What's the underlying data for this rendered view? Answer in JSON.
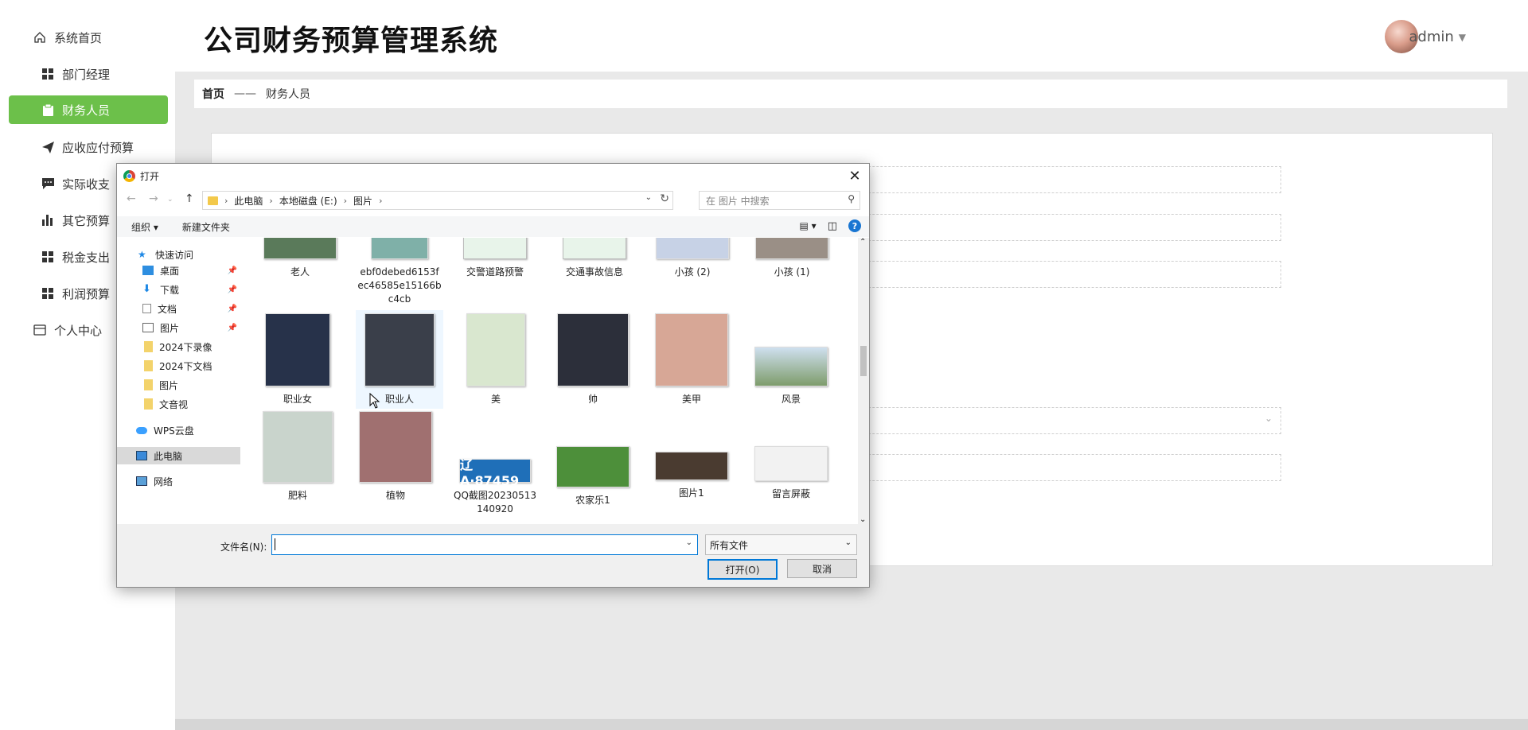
{
  "app": {
    "title": "公司财务预算管理系统",
    "user": "admin"
  },
  "sidebar": {
    "items": [
      {
        "label": "系统首页",
        "icon": "home-icon"
      },
      {
        "label": "部门经理",
        "icon": "grid-icon"
      },
      {
        "label": "财务人员",
        "icon": "clipboard-icon",
        "active": true
      },
      {
        "label": "应收应付预算",
        "icon": "send-icon"
      },
      {
        "label": "实际收支",
        "icon": "chat-icon"
      },
      {
        "label": "其它预算",
        "icon": "bar-chart-icon"
      },
      {
        "label": "税金支出",
        "icon": "grid-icon"
      },
      {
        "label": "利润预算",
        "icon": "grid-icon"
      },
      {
        "label": "个人中心",
        "icon": "card-icon"
      }
    ]
  },
  "breadcrumb": {
    "home": "首页",
    "sep": "——",
    "current": "财务人员"
  },
  "dialog": {
    "title": "打开",
    "path": [
      "此电脑",
      "本地磁盘 (E:)",
      "图片"
    ],
    "search_placeholder": "在 图片 中搜索",
    "toolbar": {
      "organize": "组织 ▾",
      "new_folder": "新建文件夹"
    },
    "tree": [
      {
        "label": "快速访问",
        "icon": "star-icon"
      },
      {
        "label": "桌面",
        "icon": "desktop-icon",
        "pinned": true
      },
      {
        "label": "下载",
        "icon": "download-icon",
        "pinned": true
      },
      {
        "label": "文档",
        "icon": "document-icon",
        "pinned": true
      },
      {
        "label": "图片",
        "icon": "picture-icon",
        "pinned": true
      },
      {
        "label": "2024下录像",
        "icon": "folder-icon"
      },
      {
        "label": "2024下文档",
        "icon": "folder-icon"
      },
      {
        "label": "图片",
        "icon": "folder-icon"
      },
      {
        "label": "文音视",
        "icon": "folder-icon"
      },
      {
        "label": "WPS云盘",
        "icon": "cloud-icon"
      },
      {
        "label": "此电脑",
        "icon": "computer-icon",
        "selected": true
      },
      {
        "label": "网络",
        "icon": "network-icon"
      }
    ],
    "files": [
      {
        "name": "老人",
        "color": "#5a7a5a"
      },
      {
        "name": "ebf0debed6153fec46585e15166bc4cb",
        "color": "#7fb0a8"
      },
      {
        "name": "交警道路预警",
        "color": "#e8f4ea"
      },
      {
        "name": "交通事故信息",
        "color": "#e8f4ea"
      },
      {
        "name": "小孩 (2)",
        "color": "#c7d2e6"
      },
      {
        "name": "小孩 (1)",
        "color": "#9a8f86"
      },
      {
        "name": "职业女",
        "color": "#27324a"
      },
      {
        "name": "职业人",
        "color": "#3a3f4a"
      },
      {
        "name": "美",
        "color": "#d9e7cf"
      },
      {
        "name": "帅",
        "color": "#2c2f3a"
      },
      {
        "name": "美甲",
        "color": "#d7a796"
      },
      {
        "name": "风景",
        "color": "#7e9c6b"
      },
      {
        "name": "肥料",
        "color": "#c9d4cc"
      },
      {
        "name": "植物",
        "color": "#a07070"
      },
      {
        "name": "QQ截图20230513140920",
        "color": "#1f6fb8"
      },
      {
        "name": "农家乐1",
        "color": "#4d8f3a"
      },
      {
        "name": "图片1",
        "color": "#4a3b30"
      },
      {
        "name": "留言屏蔽",
        "color": "#f2f2f2"
      }
    ],
    "plate_text": "辽A·87459",
    "filename_label": "文件名(N):",
    "filename_value": "",
    "filetype": "所有文件",
    "open_label": "打开(O)",
    "cancel_label": "取消"
  },
  "colors": {
    "accent": "#6cc04a",
    "dialog_focus": "#0078d7"
  }
}
